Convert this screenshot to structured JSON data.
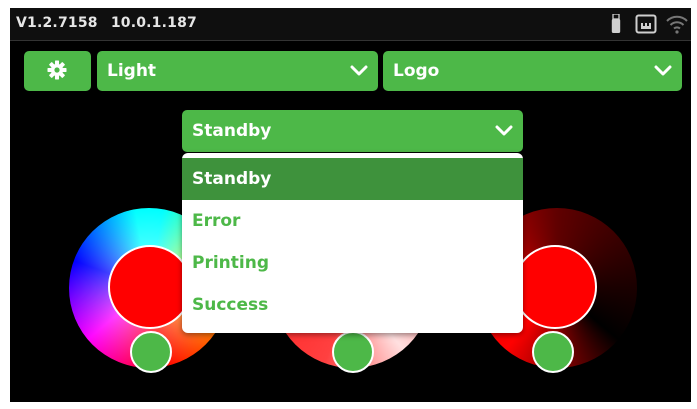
{
  "status_bar": {
    "version": "V1.2.7158",
    "ip": "10.0.1.187",
    "icons": [
      "usb-icon",
      "ethernet-icon",
      "wifi-icon"
    ]
  },
  "toolbar": {
    "settings_icon": "gear-icon",
    "light_dropdown": {
      "value": "Light"
    },
    "logo_dropdown": {
      "value": "Logo"
    }
  },
  "state_dropdown": {
    "value": "Standby",
    "options": [
      "Standby",
      "Error",
      "Printing",
      "Success"
    ],
    "selected_index": 0
  },
  "colors": {
    "accent": "#4db848",
    "accent_selected": "#3e923c",
    "background": "#000000",
    "current_color": "#ff0000"
  }
}
